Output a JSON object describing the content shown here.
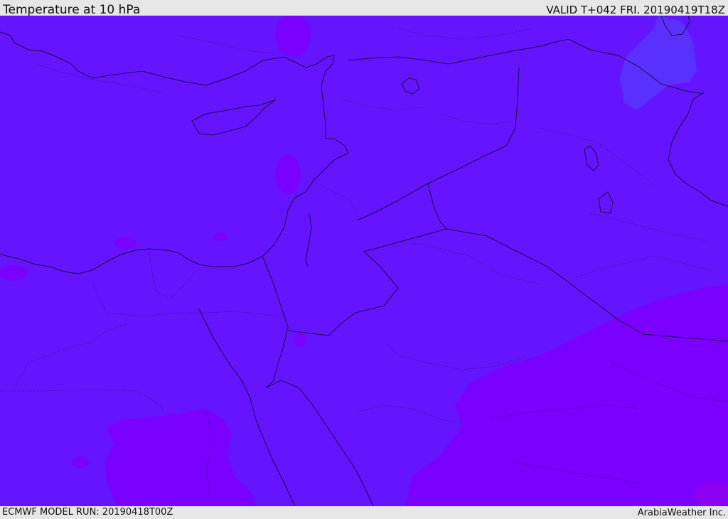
{
  "header": {
    "title": "Temperature at 10 hPa",
    "valid": "VALID T+042 FRI. 20190419T18Z"
  },
  "footer": {
    "model_run": "ECMWF MODEL RUN: 20190418T00Z",
    "credit": "ArabiaWeather Inc."
  },
  "map": {
    "colors": {
      "base_fill": "#6514ff",
      "warm_fill": "#7a00ff",
      "cool_fill": "#5a30ff",
      "coastline": "#1a1040",
      "border_dotted": "#2a1a60"
    }
  }
}
